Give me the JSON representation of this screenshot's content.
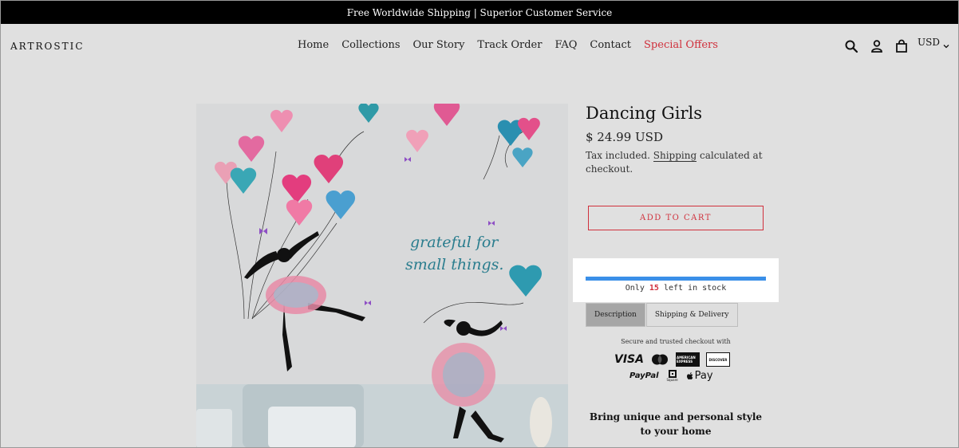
{
  "announcement": "Free Worldwide Shipping | Superior Customer Service",
  "header": {
    "logo": "ARTROSTIC",
    "nav": [
      {
        "label": "Home"
      },
      {
        "label": "Collections"
      },
      {
        "label": "Our Story"
      },
      {
        "label": "Track Order"
      },
      {
        "label": "FAQ"
      },
      {
        "label": "Contact"
      },
      {
        "label": "Special Offers"
      }
    ],
    "icons": [
      "search-icon",
      "account-icon",
      "cart-icon"
    ],
    "currency": "USD"
  },
  "product": {
    "title": "Dancing Girls",
    "price": "$ 24.99 USD",
    "tax_prefix": "Tax included. ",
    "tax_link": "Shipping",
    "tax_suffix": " calculated at checkout.",
    "add_to_cart": "ADD TO CART",
    "image_text_line1": "grateful for",
    "image_text_line2": "small things."
  },
  "stock": {
    "bar_label": "15",
    "prefix": "Only ",
    "count": "15",
    "suffix": " left in stock",
    "fill_percent": 100
  },
  "tabs": [
    {
      "label": "Description",
      "active": true
    },
    {
      "label": "Shipping & Delivery",
      "active": false
    }
  ],
  "payments": {
    "heading": "Secure and trusted checkout with",
    "visa": "VISA",
    "amex": "AMERICAN EXPRESS",
    "discover": "DISCOVER",
    "paypal": "PayPal",
    "square": "Square",
    "applepay": "Pay"
  },
  "tagline": "Bring unique and personal style to your home",
  "colors": {
    "accent": "#d0303c",
    "stock_bar": "#3a8fe8",
    "background": "#e0e0e0"
  }
}
